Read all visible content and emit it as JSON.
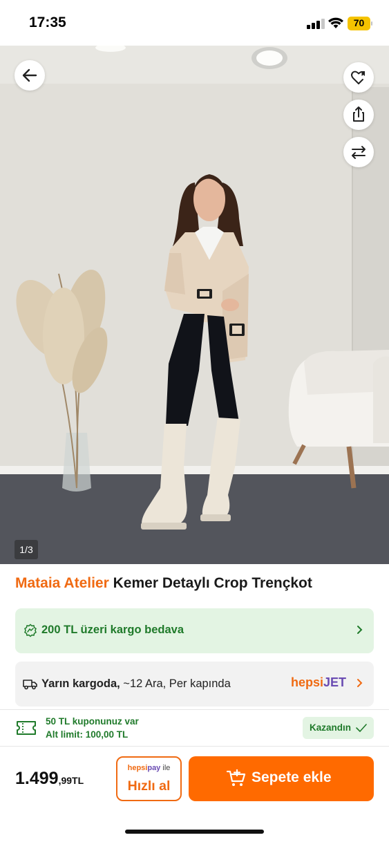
{
  "status_bar": {
    "time": "17:35",
    "battery": "70"
  },
  "gallery": {
    "counter": "1/3"
  },
  "product": {
    "brand": "Mataia Atelier",
    "name": "Kemer Detaylı Crop Trençkot"
  },
  "shipping": {
    "text": "200 TL üzeri kargo bedava"
  },
  "delivery": {
    "bold": "Yarın kargoda,",
    "rest": " ~12 Ara, Per kapında",
    "carrier_hepsi": "hepsi",
    "carrier_jet": "JET"
  },
  "coupon": {
    "line1": "50 TL kuponunuz var",
    "line2": "Alt limit: 100,00 TL",
    "badge": "Kazandın"
  },
  "purchase": {
    "price_main": "1.499",
    "price_decimal": ",99TL",
    "quick_pay_brand1": "hepsi",
    "quick_pay_brand2": "pay",
    "quick_pay_suffix": " ile",
    "quick_buy_label": "Hızlı al",
    "add_to_cart_label": "Sepete ekle"
  },
  "colors": {
    "accent": "#ff6a00",
    "brand_orange": "#f06a12",
    "green": "#1f7a2a",
    "green_bg": "#e3f4e3",
    "purple": "#6a4bb2"
  }
}
